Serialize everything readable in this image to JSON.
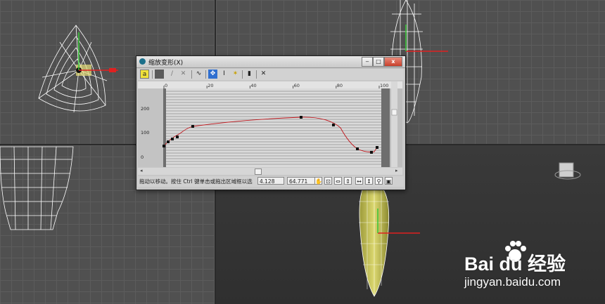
{
  "dialog": {
    "title": "缩放变形(X)",
    "window_buttons": {
      "minimize": "‒",
      "maximize": "□",
      "close": "x"
    },
    "graph": {
      "top_ruler_labels": [
        "0",
        "20",
        "40",
        "60",
        "80",
        "100"
      ],
      "left_ruler_labels": [
        "200",
        "100",
        "0"
      ]
    },
    "status": {
      "hint": "拖动以移动。按住 Ctrl 键单击或拖出区域框以选",
      "x_value": "4.128",
      "y_value": "64.771"
    }
  },
  "watermark": {
    "brand": "Bai du 经验",
    "url": "jingyan.baidu.com"
  },
  "colors": {
    "curve": "#c0151b",
    "dialog_bg": "#c8c8c8",
    "viewport_bg": "#505050"
  }
}
